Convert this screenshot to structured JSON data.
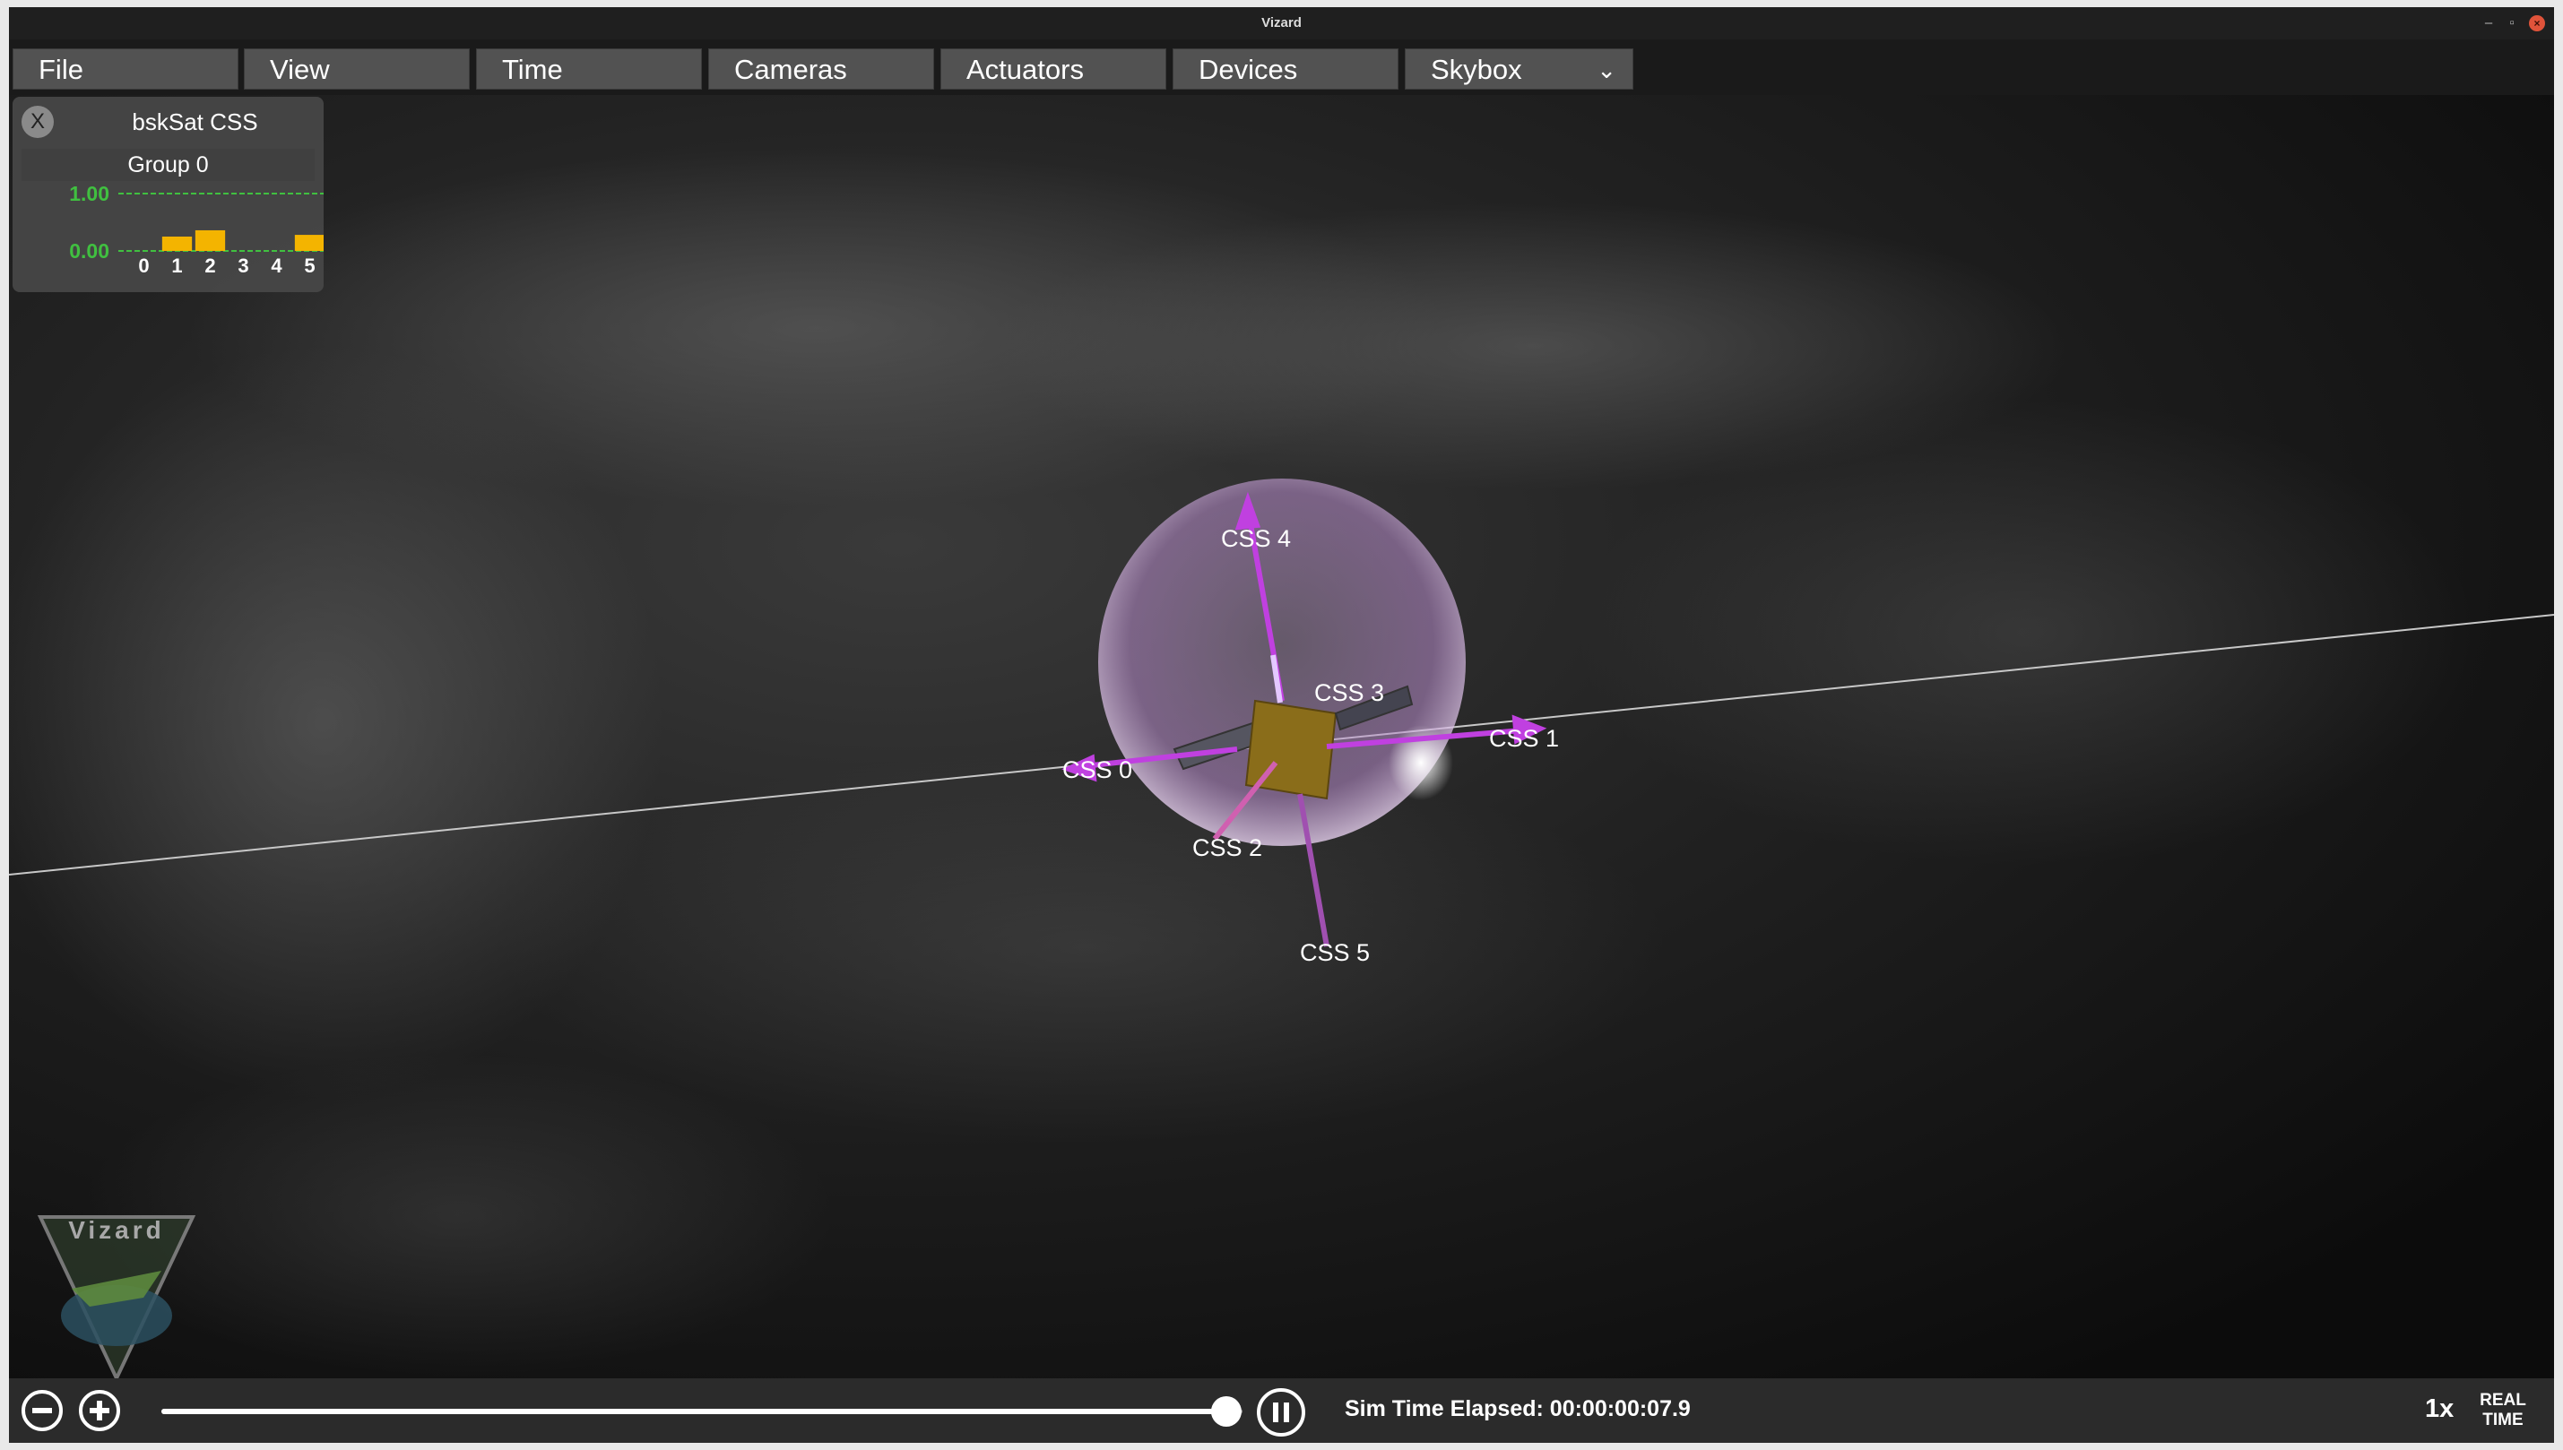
{
  "window": {
    "title": "Vizard",
    "minimize_glyph": "–",
    "maximize_glyph": "▫",
    "close_glyph": "×"
  },
  "menubar": {
    "items": [
      {
        "label": "File"
      },
      {
        "label": "View"
      },
      {
        "label": "Time"
      },
      {
        "label": "Cameras"
      },
      {
        "label": "Actuators"
      },
      {
        "label": "Devices"
      },
      {
        "label": "Skybox",
        "icon": "chevron-down-icon"
      }
    ],
    "skybox_chevron": "⌄"
  },
  "css_panel": {
    "close_label": "X",
    "title": "bskSat CSS",
    "group_label": "Group 0",
    "accent_color": "#40c040",
    "bar_color": "#f4b400"
  },
  "chart_data": {
    "type": "bar",
    "title": "Group 0",
    "categories": [
      "0",
      "1",
      "2",
      "3",
      "4",
      "5"
    ],
    "values": [
      0.0,
      0.25,
      0.36,
      0.0,
      0.0,
      0.28
    ],
    "ylim": [
      0,
      1
    ],
    "ytick_labels": [
      "1.00",
      "0.00"
    ]
  },
  "scene": {
    "sensor_labels": [
      "CSS 4",
      "CSS 3",
      "CSS 1",
      "CSS 0",
      "CSS 2",
      "CSS 5"
    ],
    "arrow_color": "#c040e0",
    "sphere_color": "#d8b8e8"
  },
  "logo": {
    "text": "Vizard"
  },
  "bottombar": {
    "zoom_out_icon": "minus-circle-icon",
    "zoom_in_icon": "plus-circle-icon",
    "pause_icon": "pause-icon",
    "timeline_progress": 0.985,
    "sim_time_text": "Sim Time Elapsed: 00:00:00:07.9",
    "speed": "1x",
    "realtime_line1": "REAL",
    "realtime_line2": "TIME"
  }
}
